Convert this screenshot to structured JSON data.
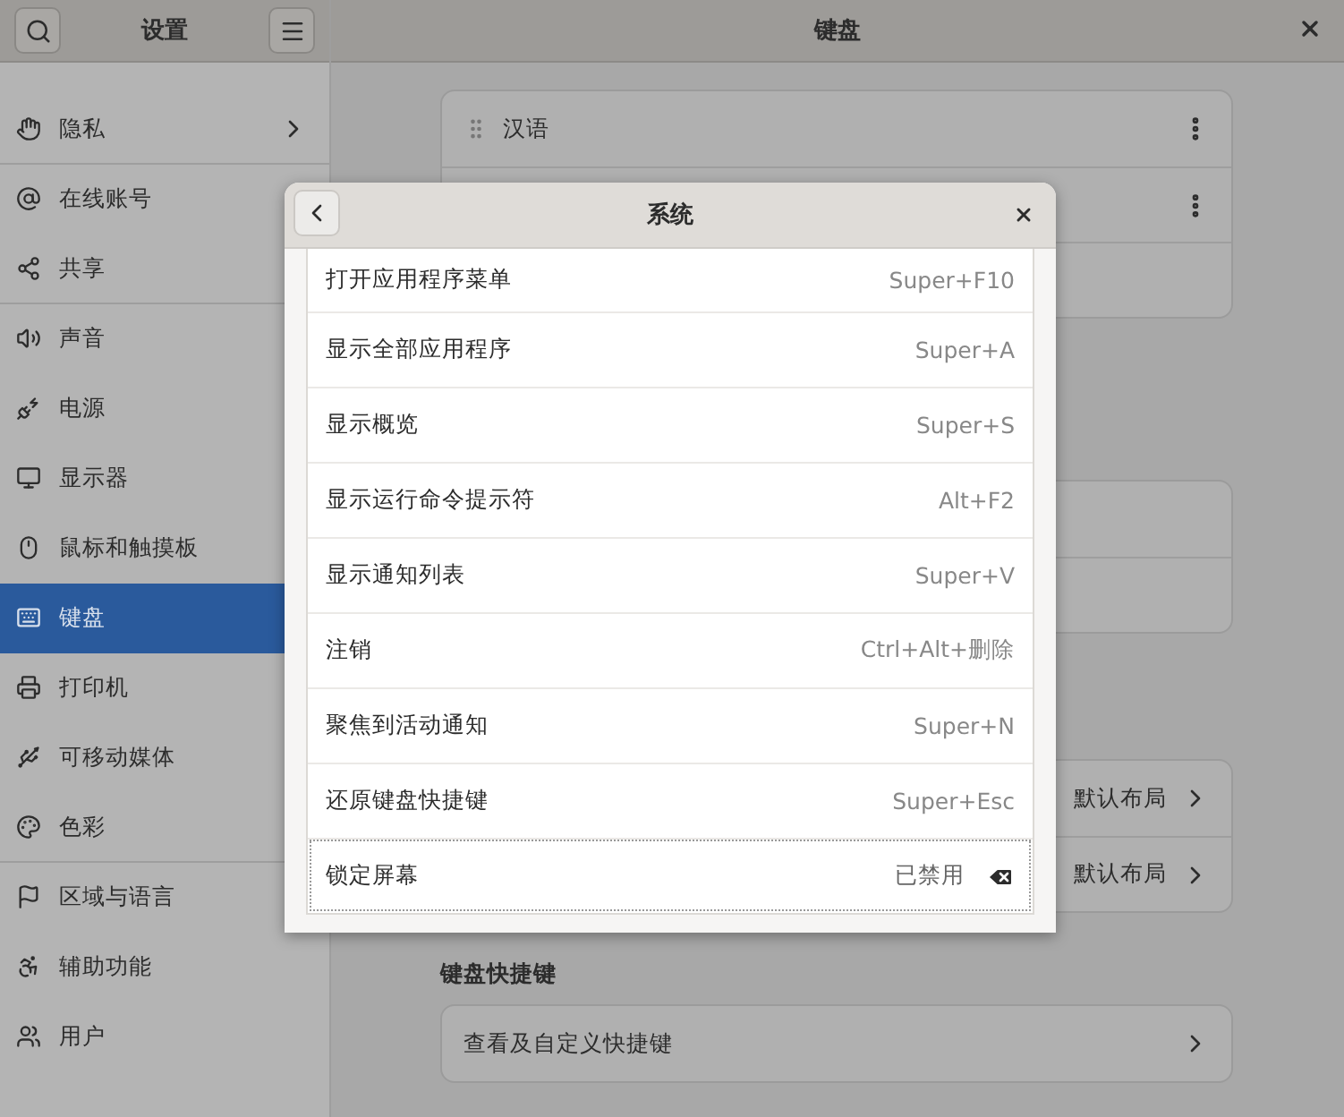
{
  "sidebar": {
    "title": "设置",
    "items": [
      {
        "label": "隐私",
        "chevron": true,
        "selected": false,
        "divider_after": true
      },
      {
        "label": "在线账号",
        "selected": false,
        "divider_after": false
      },
      {
        "label": "共享",
        "selected": false,
        "divider_after": true
      },
      {
        "label": "声音",
        "selected": false,
        "divider_after": false
      },
      {
        "label": "电源",
        "selected": false,
        "divider_after": false
      },
      {
        "label": "显示器",
        "selected": false,
        "divider_after": false
      },
      {
        "label": "鼠标和触摸板",
        "selected": false,
        "divider_after": false
      },
      {
        "label": "键盘",
        "selected": true,
        "divider_after": false
      },
      {
        "label": "打印机",
        "selected": false,
        "divider_after": false
      },
      {
        "label": "可移动媒体",
        "selected": false,
        "divider_after": false
      },
      {
        "label": "色彩",
        "selected": false,
        "divider_after": true
      },
      {
        "label": "区域与语言",
        "selected": false,
        "divider_after": false
      },
      {
        "label": "辅助功能",
        "selected": false,
        "divider_after": false
      },
      {
        "label": "用户",
        "selected": false,
        "divider_after": false
      }
    ]
  },
  "main": {
    "title": "键盘",
    "cards": [
      {
        "rows": [
          {
            "kind": "source",
            "label": "汉语"
          },
          {
            "kind": "source"
          },
          {
            "kind": "blank"
          }
        ]
      },
      {
        "rows": [
          {
            "kind": "blank"
          },
          {
            "kind": "blank"
          }
        ]
      },
      {
        "rows": [
          {
            "kind": "link",
            "value": "默认布局"
          },
          {
            "kind": "link",
            "value": "默认布局"
          }
        ]
      },
      {
        "heading": "键盘快捷键",
        "rows": [
          {
            "kind": "link",
            "label": "查看及自定义快捷键"
          }
        ]
      }
    ]
  },
  "dialog": {
    "title": "系统",
    "rows": [
      {
        "label": "打开应用程序菜单",
        "accel": "Super+F10",
        "kind": "shortcut",
        "focused": false
      },
      {
        "label": "显示全部应用程序",
        "accel": "Super+A",
        "kind": "shortcut",
        "focused": false
      },
      {
        "label": "显示概览",
        "accel": "Super+S",
        "kind": "shortcut",
        "focused": false
      },
      {
        "label": "显示运行命令提示符",
        "accel": "Alt+F2",
        "kind": "shortcut",
        "focused": false
      },
      {
        "label": "显示通知列表",
        "accel": "Super+V",
        "kind": "shortcut",
        "focused": false
      },
      {
        "label": "注销",
        "accel": "Ctrl+Alt+删除",
        "kind": "shortcut",
        "focused": false
      },
      {
        "label": "聚焦到活动通知",
        "accel": "Super+N",
        "kind": "shortcut",
        "focused": false
      },
      {
        "label": "还原键盘快捷键",
        "accel": "Super+Esc",
        "kind": "shortcut",
        "focused": false
      },
      {
        "label": "锁定屏幕",
        "accel": "已禁用",
        "kind": "disabled",
        "focused": true
      }
    ]
  }
}
